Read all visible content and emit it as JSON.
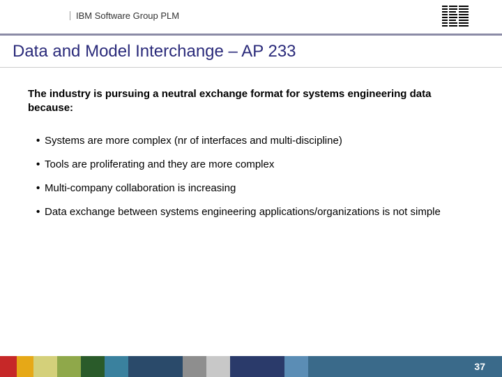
{
  "header": {
    "group_label": "IBM Software Group PLM",
    "logo_alt": "IBM"
  },
  "title": "Data and Model Interchange – AP 233",
  "intro": "The industry is pursuing a neutral exchange format for systems engineering data because:",
  "bullets": [
    "Systems are more complex (nr of interfaces and multi-discipline)",
    "Tools are proliferating and they are more complex",
    "Multi-company collaboration is increasing",
    "Data exchange between systems engineering applications/organizations is not simple"
  ],
  "footer": {
    "colors": [
      "#c62828",
      "#e6a817",
      "#d4d07a",
      "#8fa84a",
      "#2a5b2a",
      "#3a819e",
      "#2a4a6a",
      "#8e8e8e",
      "#c8c8c8",
      "#2a3a6a",
      "#5b8db5",
      "#3a6a8a"
    ],
    "page_number": "37"
  }
}
